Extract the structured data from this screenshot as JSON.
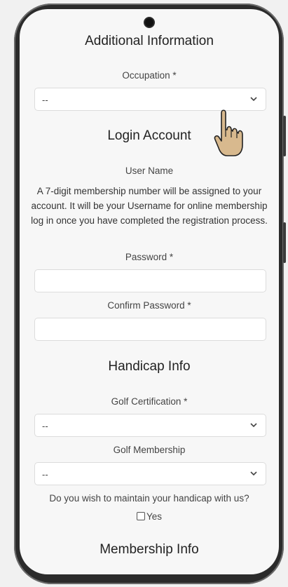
{
  "additional": {
    "title": "Additional Information",
    "occupation_label": "Occupation *",
    "occupation_value": "--"
  },
  "login": {
    "title": "Login Account",
    "username_label": "User Name",
    "username_note": "A 7-digit membership number will be assigned to your account. It will be your Username for online membership log in once you have completed the registration process.",
    "password_label": "Password *",
    "password_value": "",
    "confirm_label": "Confirm Password *",
    "confirm_value": ""
  },
  "handicap": {
    "title": "Handicap Info",
    "certification_label": "Golf Certification *",
    "certification_value": "--",
    "membership_label": "Golf Membership",
    "membership_value": "--",
    "maintain_question": "Do you wish to maintain your handicap with us?",
    "yes_label": "Yes",
    "yes_checked": false
  },
  "membership": {
    "title": "Membership Info"
  },
  "icons": {
    "select": "chevron-down-icon",
    "pointer": "hand-pointer-icon"
  },
  "colors": {
    "page_bg": "#f1f1f1",
    "screen_bg": "#f7f7f7",
    "device": "#2b2b2b",
    "field_border": "#dcdcdc",
    "hand_fill": "#d8b98e"
  }
}
